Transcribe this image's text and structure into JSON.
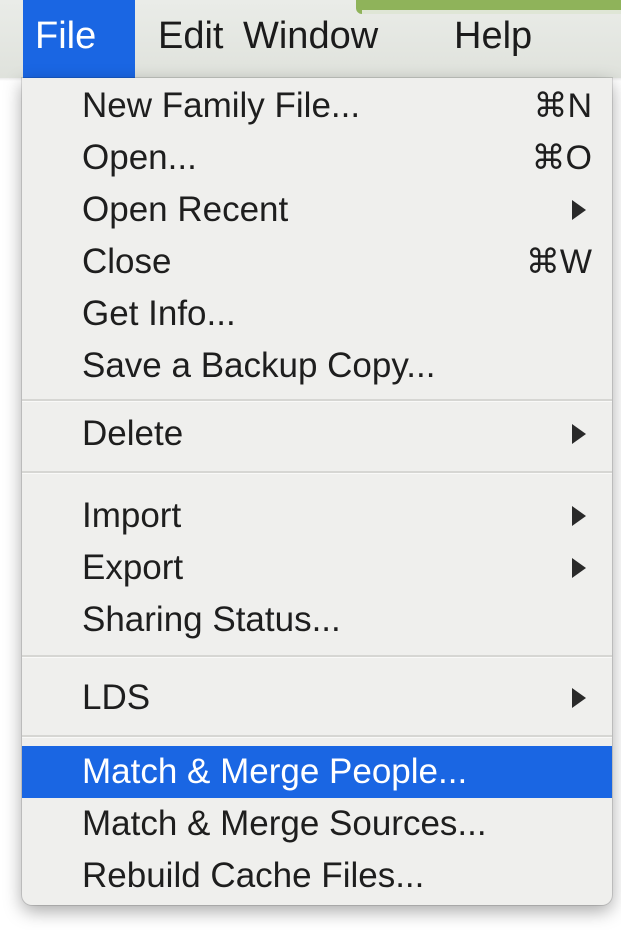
{
  "menubar": {
    "titles": [
      "File",
      "Edit",
      "Window",
      "Help"
    ],
    "active": "File"
  },
  "menu": {
    "items": [
      {
        "label": "New Family File...",
        "shortcut": "⌘N"
      },
      {
        "label": "Open...",
        "shortcut": "⌘O"
      },
      {
        "label": "Open Recent",
        "submenu": true
      },
      {
        "label": "Close",
        "shortcut": "⌘W"
      },
      {
        "label": "Get Info..."
      },
      {
        "label": "Save a Backup Copy..."
      },
      {
        "label": "Delete",
        "submenu": true
      },
      {
        "label": "Import",
        "submenu": true
      },
      {
        "label": "Export",
        "submenu": true
      },
      {
        "label": "Sharing Status..."
      },
      {
        "label": "LDS",
        "submenu": true
      },
      {
        "label": "Match & Merge People...",
        "highlighted": true
      },
      {
        "label": "Match & Merge Sources..."
      },
      {
        "label": "Rebuild Cache Files..."
      }
    ]
  },
  "colors": {
    "highlight": "#1a66e3",
    "menu_background": "#efefed"
  }
}
